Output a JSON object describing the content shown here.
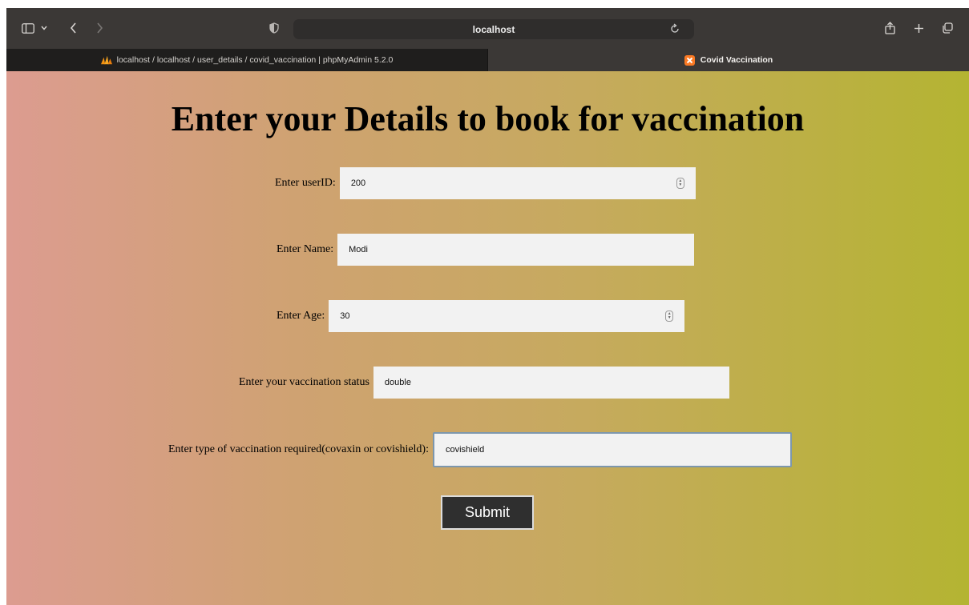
{
  "browser": {
    "address": "localhost",
    "tabs": [
      {
        "label": "localhost / localhost / user_details / covid_vaccination | phpMyAdmin 5.2.0",
        "active": false,
        "icon": "phpmyadmin-icon"
      },
      {
        "label": "Covid Vaccination",
        "active": true,
        "icon": "xampp-icon"
      }
    ]
  },
  "page": {
    "heading": "Enter your Details to book for vaccination",
    "fields": {
      "userid": {
        "label": "Enter userID:",
        "value": "200"
      },
      "name": {
        "label": "Enter Name:",
        "value": "Modi"
      },
      "age": {
        "label": "Enter Age:",
        "value": "30"
      },
      "status": {
        "label": "Enter your vaccination status",
        "value": "double"
      },
      "type": {
        "label": "Enter type of vaccination required(covaxin or covishield):",
        "value": "covishield"
      }
    },
    "submit_label": "Submit"
  },
  "colors": {
    "gradient_start": "#dc9c90",
    "gradient_end": "#b4b432",
    "button_bg": "#2f2f2f",
    "focus_border": "#7d97ad"
  }
}
